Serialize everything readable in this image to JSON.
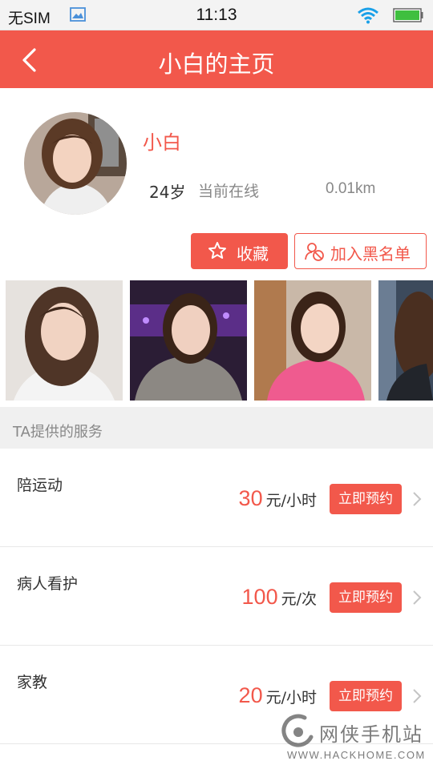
{
  "status_bar": {
    "carrier": "无SIM",
    "time": "11:13"
  },
  "header": {
    "title": "小白的主页"
  },
  "profile": {
    "name": "小白",
    "age": "24岁",
    "status": "当前在线",
    "distance": "0.01km"
  },
  "actions": {
    "favorite_label": "收藏",
    "blacklist_label": "加入黑名单"
  },
  "services": {
    "section_title": "TA提供的服务",
    "items": [
      {
        "name": "陪运动",
        "price": "30",
        "unit": "元/小时",
        "button": "立即预约"
      },
      {
        "name": "病人看护",
        "price": "100",
        "unit": "元/次",
        "button": "立即预约"
      },
      {
        "name": "家教",
        "price": "20",
        "unit": "元/小时",
        "button": "立即预约"
      }
    ]
  },
  "watermark": {
    "name": "网侠手机站",
    "url": "WWW.HACKHOME.COM"
  },
  "colors": {
    "accent": "#f2584b",
    "section_bg": "#f0f0f0"
  },
  "icons": {
    "back": "chevron-left-icon",
    "favorite": "star-icon",
    "blacklist": "user-block-icon",
    "row_arrow": "chevron-right-icon"
  }
}
